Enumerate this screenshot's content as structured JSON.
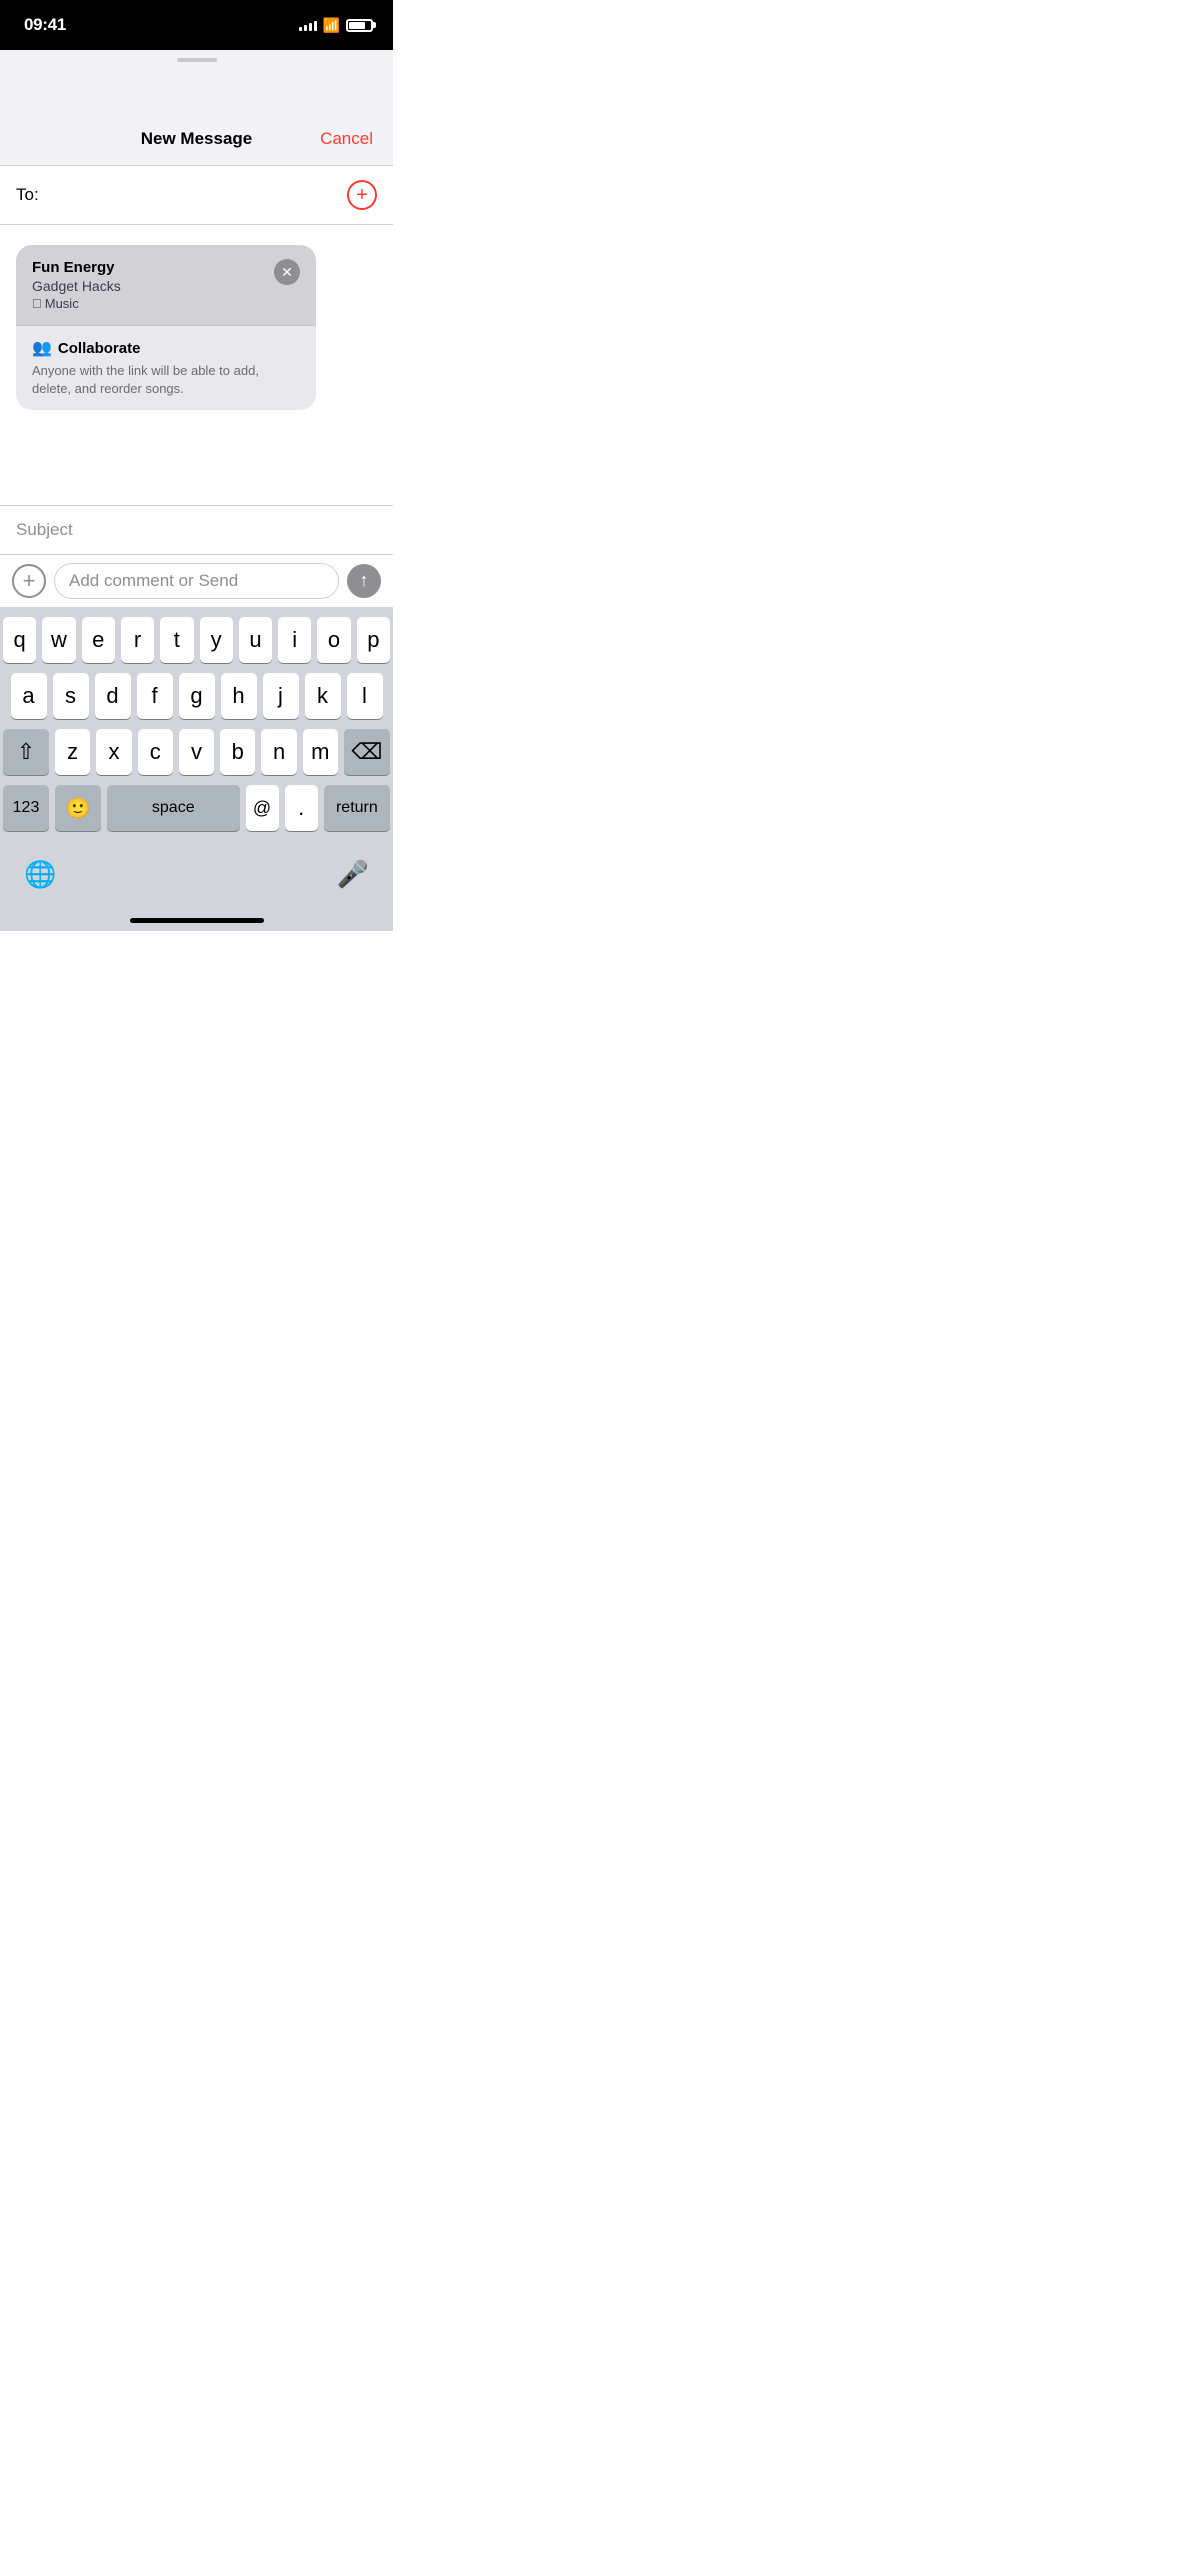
{
  "statusBar": {
    "time": "09:41",
    "signalBars": [
      4,
      6,
      8,
      10,
      12
    ],
    "battery": 75
  },
  "navBar": {
    "title": "New Message",
    "cancelLabel": "Cancel"
  },
  "toField": {
    "label": "To:",
    "placeholder": ""
  },
  "attachment": {
    "title": "Fun Energy",
    "subtitle": "Gadget Hacks",
    "source": "Music",
    "collaborateLabel": "Collaborate",
    "collaborateDesc": "Anyone with the link will be able to add, delete, and reorder songs."
  },
  "subjectField": {
    "placeholder": "Subject"
  },
  "inputToolbar": {
    "commentPlaceholder": "Add comment or Send"
  },
  "keyboard": {
    "row1": [
      "q",
      "w",
      "e",
      "r",
      "t",
      "y",
      "u",
      "i",
      "o",
      "p"
    ],
    "row2": [
      "a",
      "s",
      "d",
      "f",
      "g",
      "h",
      "j",
      "k",
      "l"
    ],
    "row3": [
      "z",
      "x",
      "c",
      "v",
      "b",
      "n",
      "m"
    ],
    "numbersLabel": "123",
    "spaceLabel": "space",
    "atLabel": "@",
    "periodLabel": ".",
    "returnLabel": "return"
  }
}
